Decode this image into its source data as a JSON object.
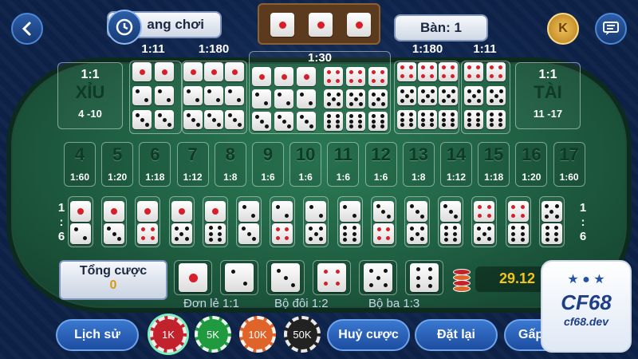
{
  "header": {
    "history_label": "ang chơi",
    "table_label": "Bàn: 1",
    "top_dice": [
      1,
      1,
      1
    ]
  },
  "ratios": {
    "single_top_left": "1:11",
    "triple_left": "1:180",
    "any_triple": "1:30",
    "triple_right": "1:180",
    "single_top_right": "1:11",
    "small_ratio": "1:1",
    "big_ratio": "1:1"
  },
  "small": {
    "label": "XỈU",
    "range": "4 -10"
  },
  "big": {
    "label": "TÀI",
    "range": "11 -17"
  },
  "sums": [
    {
      "n": "4",
      "p": "1:60"
    },
    {
      "n": "5",
      "p": "1:20"
    },
    {
      "n": "6",
      "p": "1:18"
    },
    {
      "n": "7",
      "p": "1:12"
    },
    {
      "n": "8",
      "p": "1:8"
    },
    {
      "n": "9",
      "p": "1:6"
    },
    {
      "n": "10",
      "p": "1:6"
    },
    {
      "n": "11",
      "p": "1:6"
    },
    {
      "n": "12",
      "p": "1:6"
    },
    {
      "n": "13",
      "p": "1:8"
    },
    {
      "n": "14",
      "p": "1:12"
    },
    {
      "n": "15",
      "p": "1:18"
    },
    {
      "n": "16",
      "p": "1:20"
    },
    {
      "n": "17",
      "p": "1:60"
    }
  ],
  "combo_side": {
    "left": "1 : 6",
    "right": "1 : 6"
  },
  "bet": {
    "label": "Tổng cược",
    "value": "0",
    "balance": "29.12"
  },
  "single_labels": {
    "single": "Đơn lẻ 1:1",
    "pair": "Bộ đôi 1:2",
    "triple": "Bộ ba 1:3"
  },
  "chips": [
    {
      "label": "1K",
      "color": "#c2222b"
    },
    {
      "label": "5K",
      "color": "#1f9a3e"
    },
    {
      "label": "10K",
      "color": "#e0632a"
    },
    {
      "label": "50K",
      "color": "#222222"
    }
  ],
  "buttons": {
    "history": "Lịch sử",
    "cancel": "Huỷ cược",
    "reset": "Đặt lại",
    "double": "Gấp"
  },
  "brand": {
    "name": "CF68",
    "url": "cf68.dev"
  },
  "coin_label": "K"
}
